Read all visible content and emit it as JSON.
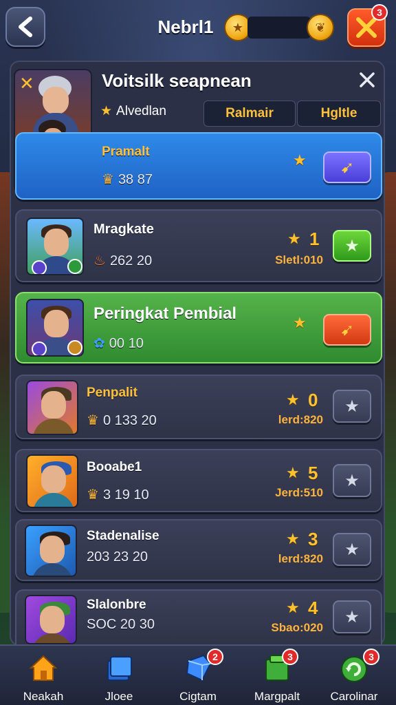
{
  "header": {
    "title": "Nebrl1",
    "close_badge": "3"
  },
  "featured": {
    "title": "Voitsilk seapnean",
    "sub_label": "Alvedlan",
    "tabs": [
      "Ralmair",
      "Hgltle"
    ],
    "player_name": "Pramalt",
    "stats": "38  87"
  },
  "rows": [
    {
      "name": "Mragkate",
      "stats": "262  20",
      "rank": "1",
      "label": "Sletl:010",
      "style": "normal",
      "btn": "green"
    },
    {
      "name": "Peringkat Pembial",
      "stats": "00  10",
      "rank": "",
      "label": "",
      "style": "green",
      "btn": "red"
    },
    {
      "name": "Penpalit",
      "stats": "0  133  20",
      "rank": "0",
      "label": "lerd:820",
      "style": "normal",
      "btn": "gray"
    },
    {
      "name": "Booabe1",
      "stats": "3  19  10",
      "rank": "5",
      "label": "Jerd:510",
      "style": "normal",
      "btn": "gray"
    },
    {
      "name": "Stadenalise",
      "stats": "203  23  20",
      "rank": "3",
      "label": "lerd:820",
      "style": "normal",
      "btn": "gray"
    },
    {
      "name": "Slalonbre",
      "stats": "SOC  20  30",
      "rank": "4",
      "label": "Sbao:020",
      "style": "normal",
      "btn": "gray"
    }
  ],
  "nav": [
    {
      "label": "Neakah",
      "badge": ""
    },
    {
      "label": "Jloee",
      "badge": ""
    },
    {
      "label": "Cigtam",
      "badge": "2"
    },
    {
      "label": "Margpalt",
      "badge": "3"
    },
    {
      "label": "Carolinar",
      "badge": "3"
    }
  ],
  "colors": {
    "accent_gold": "#ffc12e",
    "featured_blue": "#2f8ae8",
    "highlight_green": "#55b34a",
    "danger_red": "#e12a2a"
  }
}
